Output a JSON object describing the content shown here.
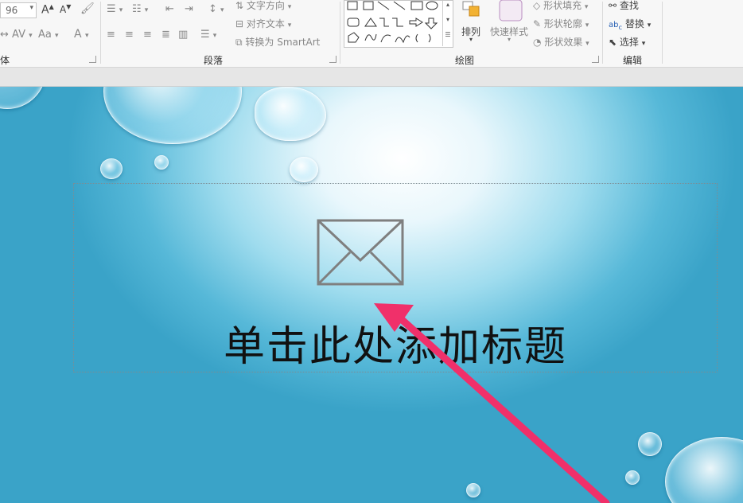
{
  "ribbon": {
    "font_group": {
      "label": "字体",
      "font_size": "96",
      "aa_label": "Aa"
    },
    "paragraph_group": {
      "label": "段落",
      "text_direction": "文字方向",
      "align_text": "对齐文本",
      "convert_smartart": "转换为 SmartArt"
    },
    "drawing_group": {
      "label": "绘图",
      "arrange": "排列",
      "quick_styles": "快速样式",
      "shape_fill": "形状填充",
      "shape_outline": "形状轮廓",
      "shape_effects": "形状效果"
    },
    "editing_group": {
      "label": "编辑",
      "find": "查找",
      "replace": "替换",
      "select": "选择"
    }
  },
  "slide": {
    "title_placeholder": "单击此处添加标题",
    "icons": [
      "envelope-icon"
    ]
  },
  "colors": {
    "arrow": "#f0306a",
    "slide_bg": "#56b8d8"
  }
}
